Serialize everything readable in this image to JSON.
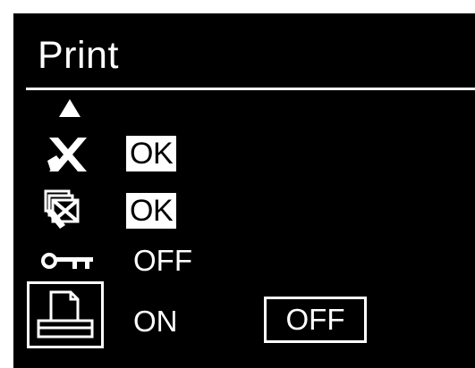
{
  "header": {
    "title": "Print"
  },
  "rows": [
    {
      "icon": "toner-x-icon",
      "value": "OK"
    },
    {
      "icon": "paper-x-icon",
      "value": "OK"
    },
    {
      "icon": "key-lock-icon",
      "value": "OFF"
    },
    {
      "icon": "print-job-icon",
      "value": "ON",
      "toggle": "OFF"
    }
  ],
  "icons": {
    "scroll": "scroll-up-arrow-icon"
  },
  "colors": {
    "background": "#000000",
    "foreground": "#ffffff",
    "bezel": "#ffffff"
  }
}
